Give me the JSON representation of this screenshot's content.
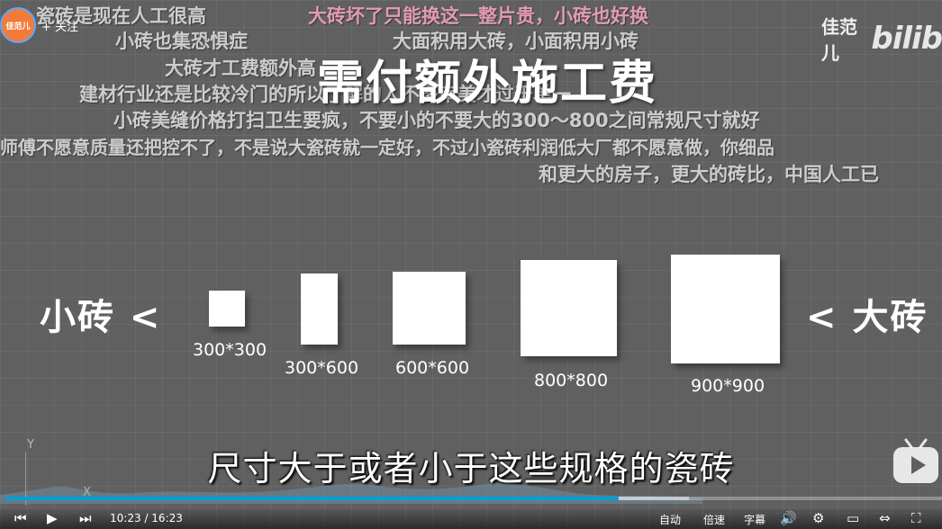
{
  "uploader": {
    "avatar_text": "佳范儿",
    "follow_label": "+ 关注"
  },
  "watermark": {
    "name": "佳范儿",
    "logo": "bilib"
  },
  "title": "需付额外施工费",
  "danmaku": [
    {
      "text": "大砖坏了只能换这一整片贵，小砖也好换",
      "pink": true
    },
    {
      "text": "瓷砖是现在人工很高",
      "pink": false
    },
    {
      "text": "小砖也集恐惧症",
      "pink": false
    },
    {
      "text": "大面积用大砖，小面积用小砖",
      "pink": false
    },
    {
      "text": "大砖才工费额外高",
      "pink": false
    },
    {
      "text": "建材行业还是比较冷门的所以了解的人不多审美才过于单一",
      "pink": false
    },
    {
      "text": "小砖美缝价格打扫卫生要疯，不要小的不要大的300～800之间常规尺寸就好",
      "pink": false
    },
    {
      "text": "师傅不愿意质量还把控不了，不是说大瓷砖就一定好，不过小瓷砖利润低大厂都不愿意做，你细品",
      "pink": false
    },
    {
      "text": "和更大的房子，更大的砖比，中国人工已",
      "pink": false
    }
  ],
  "comparison": {
    "left_label": "小砖  <",
    "right_label": "<  大砖",
    "tiles": [
      {
        "label": "300*300"
      },
      {
        "label": "300*600"
      },
      {
        "label": "600*600"
      },
      {
        "label": "800*800"
      },
      {
        "label": "900*900"
      }
    ]
  },
  "subtitle": "尺寸大于或者小于这些规格的瓷砖",
  "axis": {
    "y_label": "Y",
    "x_label": "X"
  },
  "player": {
    "current_time": "10:23",
    "separator": "/",
    "total_time": "16:23",
    "progress": 0.655,
    "buffered": 0.73,
    "quality_label": "自动",
    "speed_label": "倍速",
    "subtitle_btn_label": "字幕"
  },
  "colors": {
    "progress": "#00a1d6",
    "avatar": "#f37b3a"
  }
}
